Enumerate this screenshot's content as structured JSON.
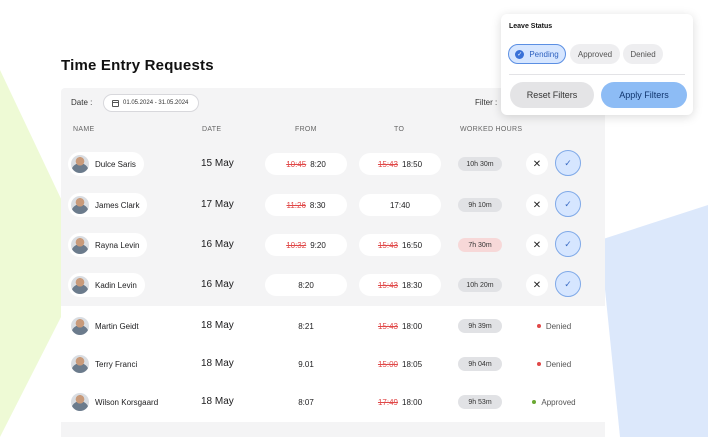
{
  "page": {
    "title": "Time Entry Requests"
  },
  "colors": {
    "accent": "#5b8fe3",
    "denied": "#e04848",
    "approved": "#6aa832",
    "bg_green": "#eefad5",
    "bg_blue": "#dce8fb"
  },
  "toolbar": {
    "date_label": "Date :",
    "date_range": "01.05.2024 - 31.05.2024",
    "filter_label": "Filter :"
  },
  "columns": {
    "name": "NAME",
    "date": "DATE",
    "from": "FROM",
    "to": "TO",
    "worked": "WORKED HOURS"
  },
  "rows": [
    {
      "name": "Dulce Saris",
      "date": "15 May",
      "from_old": "10:45",
      "from": "8:20",
      "to_old": "15:43",
      "to": "18:50",
      "hours": "10h 30m",
      "hours_warn": false,
      "status": "actions"
    },
    {
      "name": "James Clark",
      "date": "17 May",
      "from_old": "11:26",
      "from": "8:30",
      "to_old": "",
      "to": "17:40",
      "hours": "9h 10m",
      "hours_warn": false,
      "status": "actions"
    },
    {
      "name": "Rayna Levin",
      "date": "16 May",
      "from_old": "10:32",
      "from": "9:20",
      "to_old": "15:43",
      "to": "16:50",
      "hours": "7h 30m",
      "hours_warn": true,
      "status": "actions"
    },
    {
      "name": "Kadin Levin",
      "date": "16 May",
      "from_old": "",
      "from": "8:20",
      "to_old": "15:43",
      "to": "18:30",
      "hours": "10h 20m",
      "hours_warn": false,
      "status": "actions"
    },
    {
      "name": "Martin Geidt",
      "date": "18 May",
      "from_old": "",
      "from": "8:21",
      "to_old": "15:43",
      "to": "18:00",
      "hours": "9h 39m",
      "hours_warn": false,
      "status": "Denied"
    },
    {
      "name": "Terry Franci",
      "date": "18 May",
      "from_old": "",
      "from": "9.01",
      "to_old": "15:00",
      "to": "18:05",
      "hours": "9h 04m",
      "hours_warn": false,
      "status": "Denied"
    },
    {
      "name": "Wilson Korsgaard",
      "date": "18 May",
      "from_old": "",
      "from": "8:07",
      "to_old": "17:49",
      "to": "18:00",
      "hours": "9h 53m",
      "hours_warn": false,
      "status": "Approved"
    }
  ],
  "popup": {
    "title": "Leave Status",
    "chips": {
      "pending": "Pending",
      "approved": "Approved",
      "denied": "Denied"
    },
    "reset_label": "Reset Filters",
    "apply_label": "Apply Filters"
  },
  "icons": {
    "reject": "close-icon",
    "accept": "check-icon",
    "calendar": "calendar-icon"
  }
}
